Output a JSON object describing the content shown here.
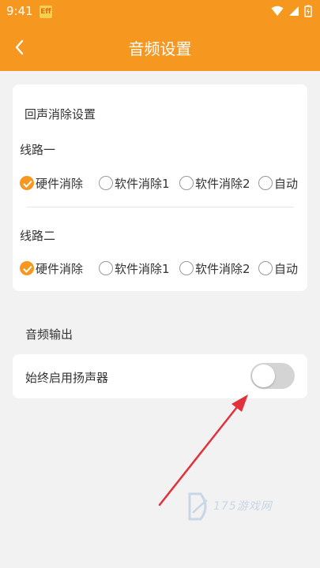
{
  "status_bar": {
    "time": "9:41",
    "app_badge": "Eff"
  },
  "header": {
    "title": "音频设置"
  },
  "echo_card": {
    "title": "回声消除设置",
    "line1": {
      "title": "线路一",
      "options": [
        "硬件消除",
        "软件消除1",
        "软件消除2",
        "自动"
      ],
      "selected": "硬件消除"
    },
    "line2": {
      "title": "线路二",
      "options": [
        "硬件消除",
        "软件消除1",
        "软件消除2",
        "自动"
      ],
      "selected": "硬件消除"
    }
  },
  "audio_output": {
    "title": "音频输出",
    "speaker": {
      "label": "始终启用扬声器",
      "enabled": false
    }
  },
  "watermark": {
    "text": "175游戏网"
  },
  "colors": {
    "accent": "#f6981f",
    "arrow": "#e0313c"
  }
}
